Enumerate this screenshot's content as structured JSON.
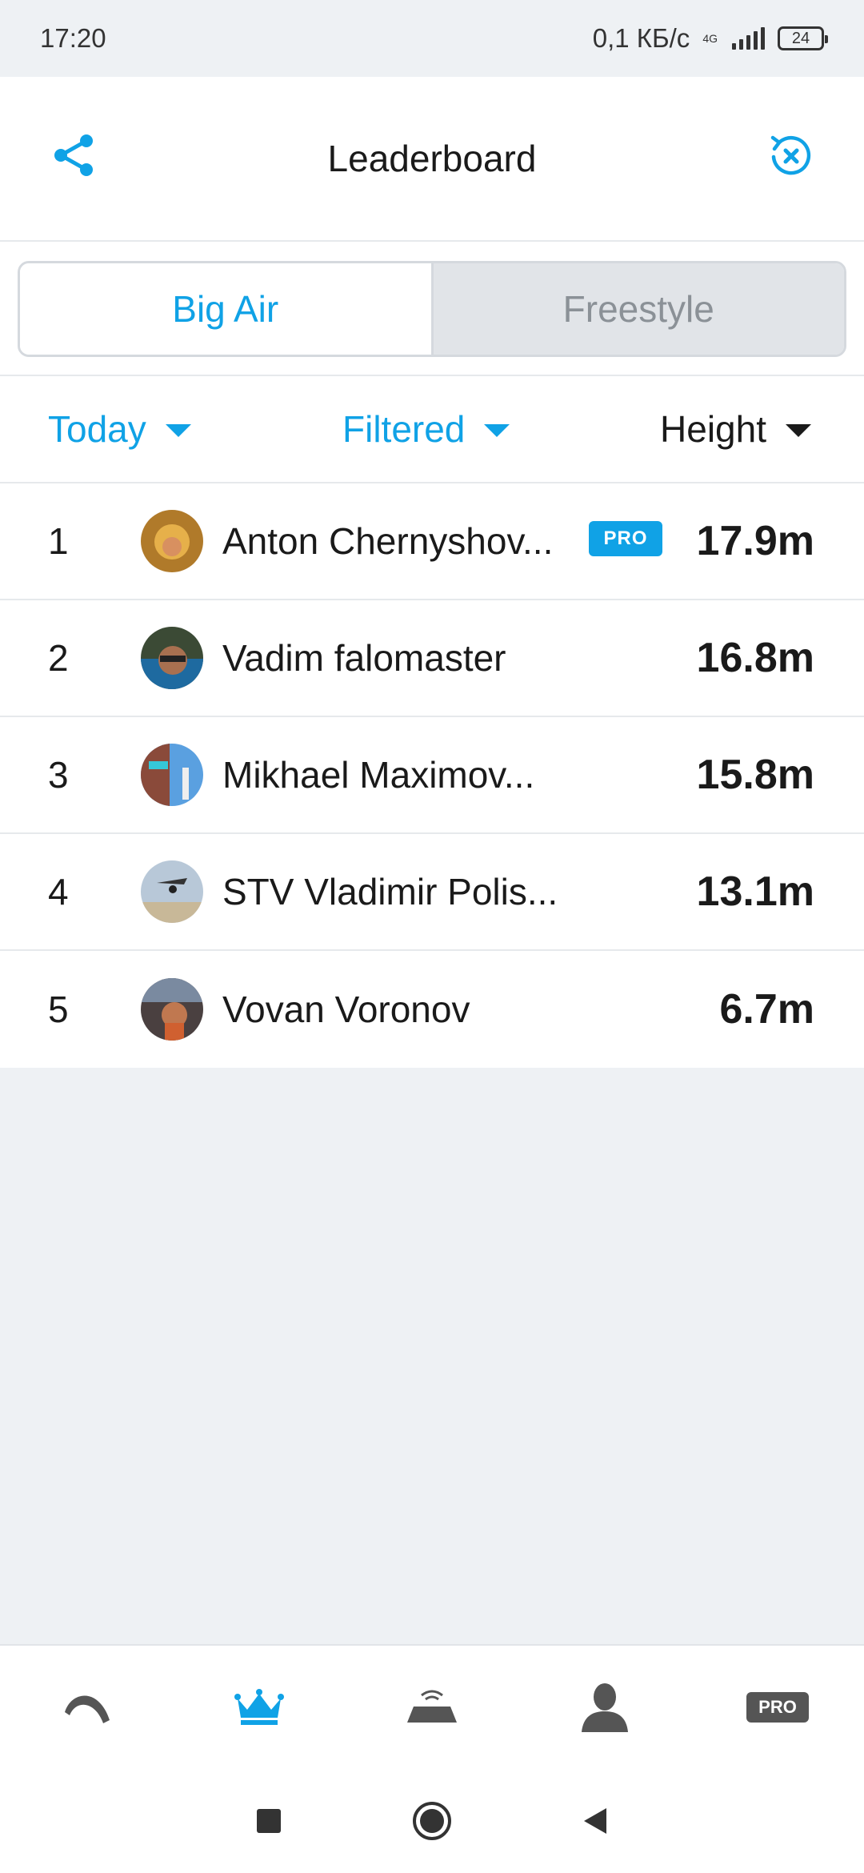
{
  "status_bar": {
    "time": "17:20",
    "net_speed": "0,1 КБ/с",
    "network": "4G",
    "battery": "24"
  },
  "header": {
    "title": "Leaderboard",
    "left_icon": "share-icon",
    "right_icon": "reset-icon"
  },
  "tabs": [
    {
      "label": "Big Air",
      "active": true
    },
    {
      "label": "Freestyle",
      "active": false
    }
  ],
  "filters": {
    "period": "Today",
    "scope": "Filtered",
    "metric": "Height"
  },
  "leaderboard": [
    {
      "rank": "1",
      "name": "Anton Chernyshov...",
      "pro": true,
      "badge": "PRO",
      "value": "17.9m"
    },
    {
      "rank": "2",
      "name": "Vadim falomaster",
      "pro": false,
      "value": "16.8m"
    },
    {
      "rank": "3",
      "name": "Mikhael Maximov...",
      "pro": false,
      "value": "15.8m"
    },
    {
      "rank": "4",
      "name": "STV Vladimir Polis...",
      "pro": false,
      "value": "13.1m"
    },
    {
      "rank": "5",
      "name": "Vovan Voronov",
      "pro": false,
      "value": "6.7m"
    }
  ],
  "bottom_nav": {
    "items": [
      "kite-icon",
      "crown-icon",
      "device-icon",
      "profile-icon",
      "pro-icon"
    ],
    "active": "crown-icon",
    "pro_label": "PRO"
  },
  "colors": {
    "accent": "#10a2e6",
    "background": "#eef1f4"
  }
}
